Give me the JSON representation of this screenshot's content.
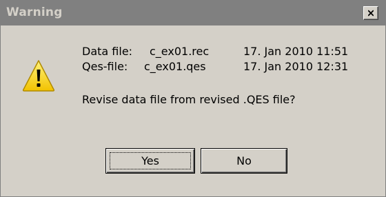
{
  "window": {
    "title": "Warning",
    "close_glyph": "X"
  },
  "message": {
    "icon": "warning-triangle-icon",
    "data_file_label": "Data file:",
    "data_file_name": "c_ex01.rec",
    "data_file_date": "17. Jan 2010 11:51",
    "qes_file_label": "Qes-file:",
    "qes_file_name": "c_ex01.qes",
    "qes_file_date": "17. Jan 2010 12:31",
    "question": "Revise data file from revised .QES file?"
  },
  "buttons": {
    "yes_label": "Yes",
    "no_label": "No"
  },
  "colors": {
    "dialog_face": "#d4d0c8",
    "titlebar_inactive": "#808080",
    "warning_yellow": "#ffd800"
  }
}
